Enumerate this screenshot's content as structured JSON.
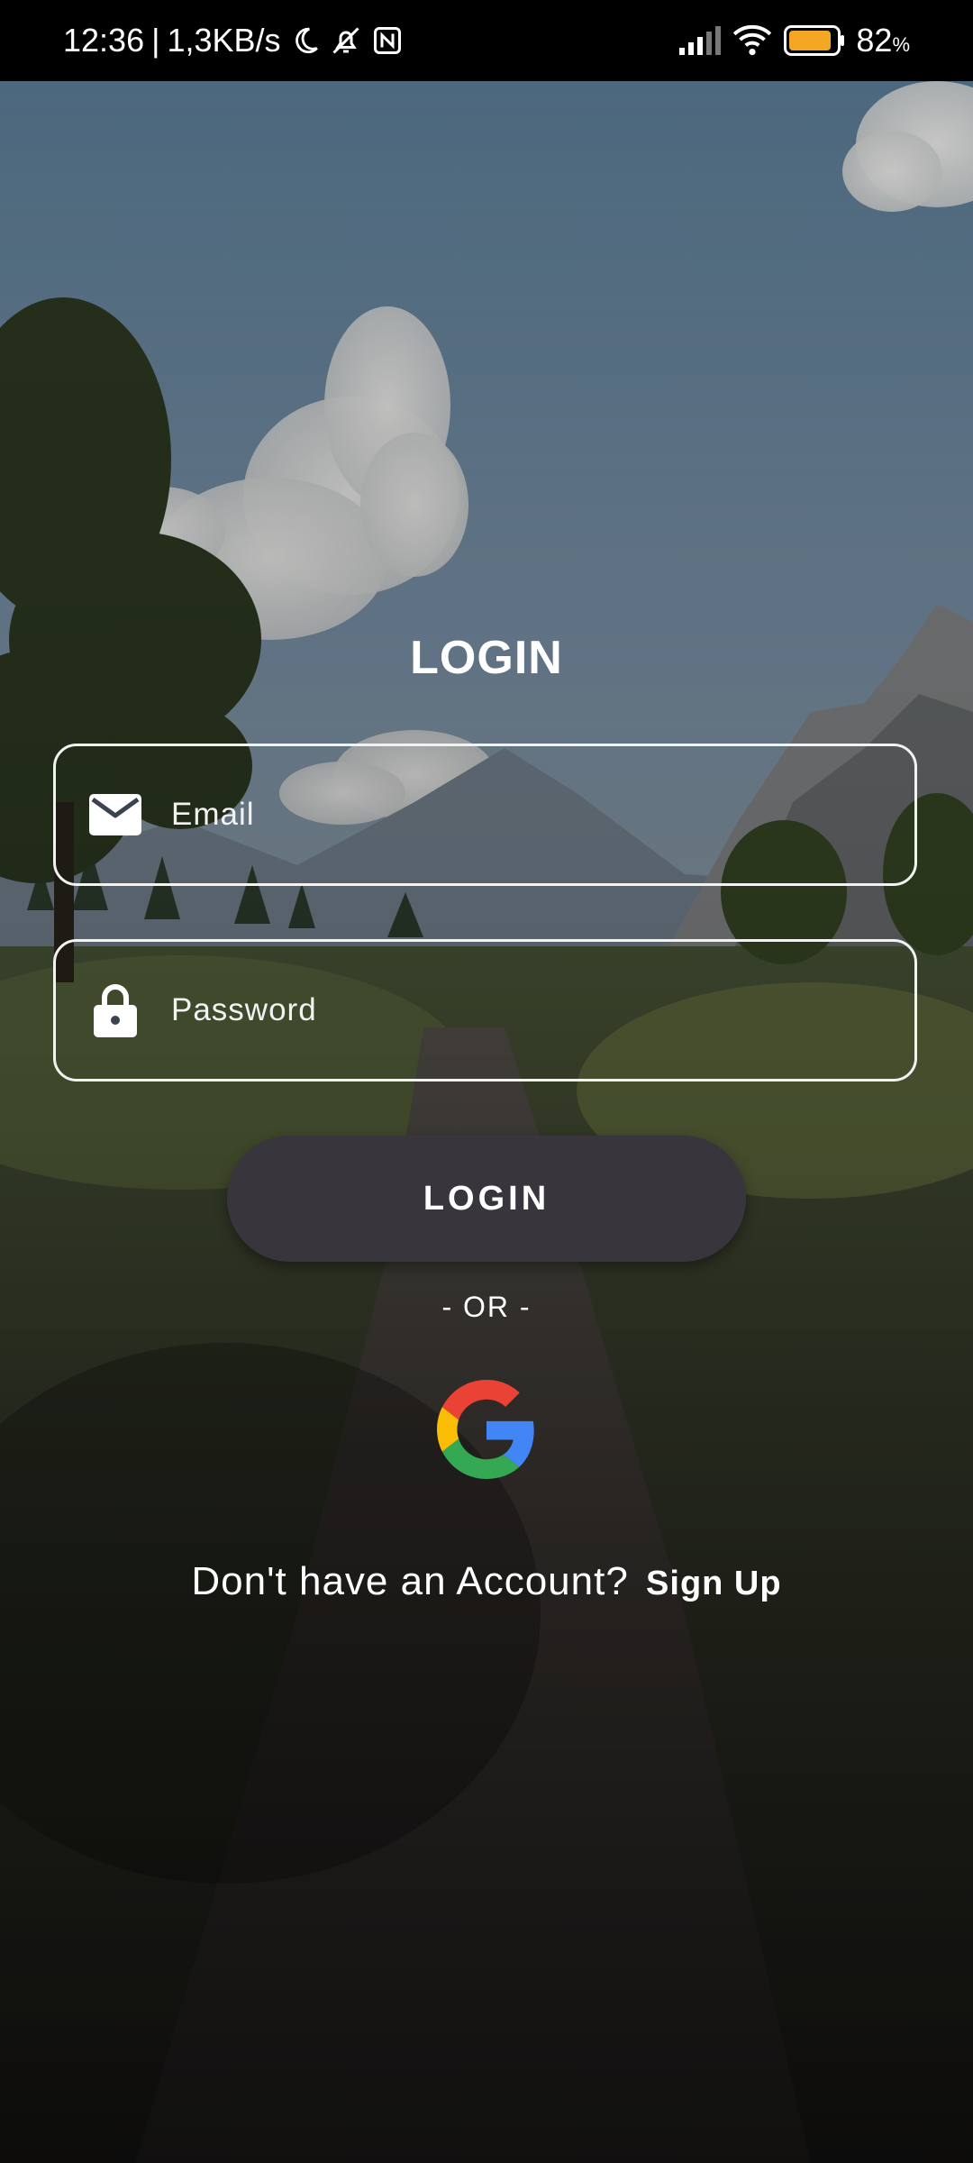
{
  "status_bar": {
    "time": "12:36",
    "separator": "|",
    "speed": "1,3KB/s",
    "battery_percent": "82",
    "battery_unit": "%",
    "icons": [
      "moon-icon",
      "bell-off-icon",
      "nfc-icon",
      "signal-icon",
      "wifi-icon",
      "battery-icon"
    ],
    "battery_color": "#f5a623"
  },
  "login": {
    "title": "LOGIN",
    "email_placeholder": "Email",
    "email_value": "",
    "password_placeholder": "Password",
    "password_value": "",
    "button_label": "LOGIN",
    "or_text": "- OR -",
    "google_icon": "google-icon",
    "signup_prompt": "Don't have an Account?",
    "signup_link": "Sign Up"
  },
  "colors": {
    "button_bg": "#38363c",
    "field_border": "#f2f2f2",
    "text": "#ffffff"
  }
}
